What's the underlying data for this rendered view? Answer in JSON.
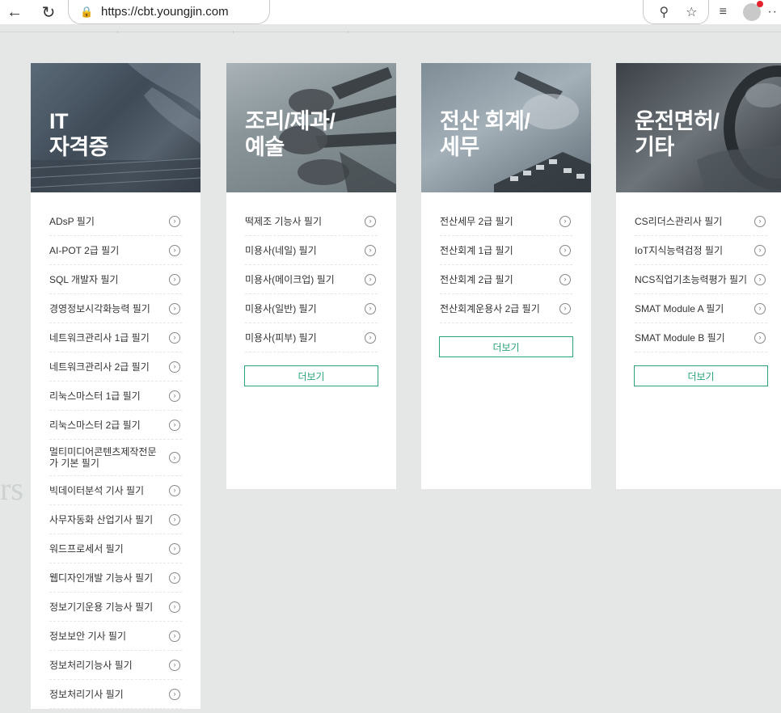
{
  "browser": {
    "url": "https://cbt.youngjin.com",
    "more": "··"
  },
  "side_text": "rs",
  "cards": [
    {
      "title": "IT\n자격증",
      "items": [
        "ADsP 필기",
        "AI-POT 2급 필기",
        "SQL 개발자 필기",
        "경영정보시각화능력 필기",
        "네트워크관리사 1급 필기",
        "네트워크관리사 2급 필기",
        "리눅스마스터 1급 필기",
        "리눅스마스터 2급 필기",
        "멀티미디어콘텐츠제작전문가 기본 필기",
        "빅데이터분석 기사 필기",
        "사무자동화 산업기사 필기",
        "워드프로세서 필기",
        "웹디자인개발 기능사 필기",
        "정보기기운용 기능사 필기",
        "정보보안 기사 필기",
        "정보처리기능사 필기",
        "정보처리기사 필기"
      ]
    },
    {
      "title": "조리/제과/\n예술",
      "items": [
        "떡제조 기능사 필기",
        "미용사(네일) 필기",
        "미용사(메이크업) 필기",
        "미용사(일반) 필기",
        "미용사(피부) 필기"
      ],
      "more": "더보기"
    },
    {
      "title": "전산 회계/\n세무",
      "items": [
        "전산세무 2급 필기",
        "전산회계 1급 필기",
        "전산회계 2급 필기",
        "전산회계운용사 2급 필기"
      ],
      "more": "더보기"
    },
    {
      "title": "운전면허/\n기타",
      "items": [
        "CS리더스관리사 필기",
        "IoT지식능력검정 필기",
        "NCS직업기초능력평가 필기",
        "SMAT Module A 필기",
        "SMAT Module B 필기"
      ],
      "more": "더보기"
    }
  ]
}
